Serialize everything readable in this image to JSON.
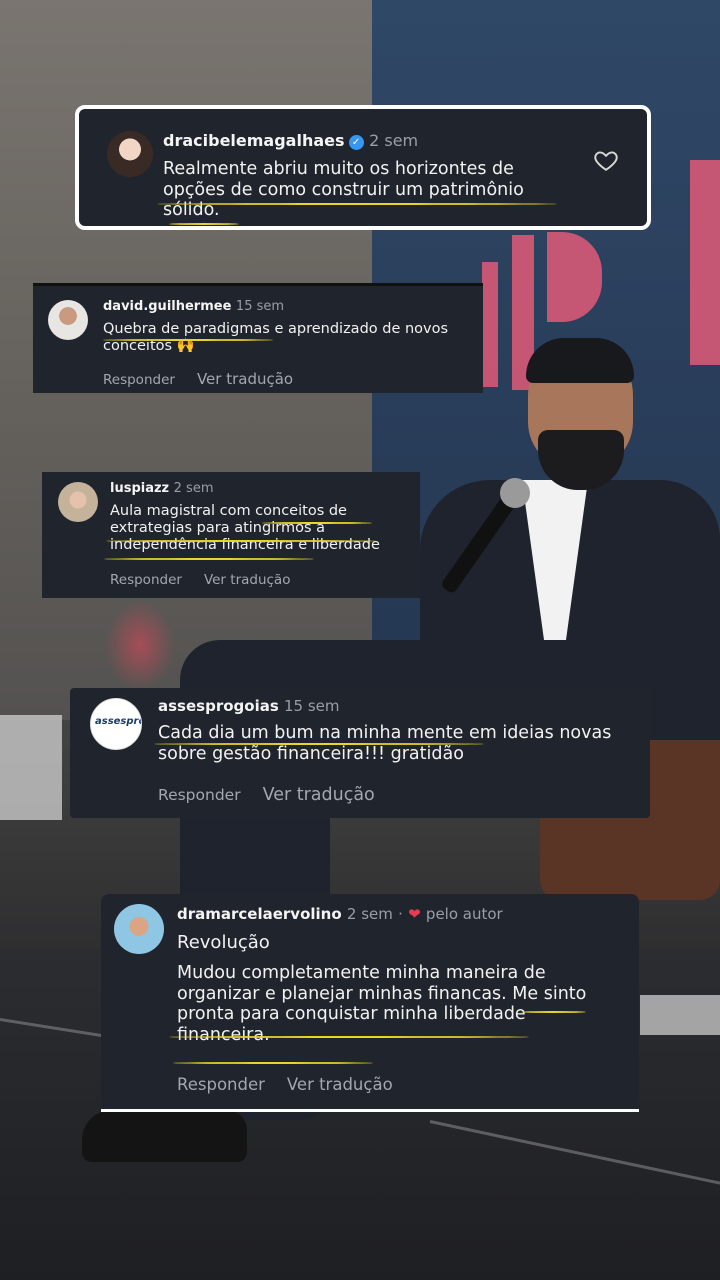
{
  "colors": {
    "card_bg": "#20242c",
    "underline": "#e7d52a",
    "verified": "#3797f0",
    "heart": "#e83b52"
  },
  "comments": [
    {
      "username": "dracibelemagalhaes",
      "time": "2 sem",
      "verified": true,
      "text": "Realmente abriu muito os horizontes de opções de como construir um patrimônio sólido.",
      "like_icon": "heart-outline-icon"
    },
    {
      "username": "david.guilhermee",
      "time": "15 sem",
      "text": "Quebra de paradigmas e aprendizado de novos conceitos 🙌",
      "reply": "Responder",
      "translate": "Ver tradução"
    },
    {
      "username": "luspiazz",
      "time": "2 sem",
      "text": "Aula magistral com conceitos de extrategias para atingirmos a independência financeira e liberdade",
      "reply": "Responder",
      "translate": "Ver tradução"
    },
    {
      "username": "assesprogoias",
      "time": "15 sem",
      "avatar_text": "assespro",
      "text": "Cada dia um bum na minha mente em ideias novas sobre gestão financeira!!! gratidão",
      "reply": "Responder",
      "translate": "Ver tradução"
    },
    {
      "username": "dramarcelaervolino",
      "time": "2 sem",
      "liked_by_author": "pelo autor",
      "title": "Revolução",
      "text": "Mudou completamente minha maneira de organizar e planejar minhas financas. Me sinto pronta para conquistar minha liberdade financeira.",
      "reply": "Responder",
      "translate": "Ver tradução"
    }
  ]
}
